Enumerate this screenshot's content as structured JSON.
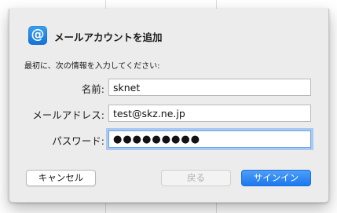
{
  "dialog": {
    "title": "メールアカウントを追加",
    "icon": "mail-at-icon",
    "icon_glyph": "@",
    "intro": "最初に、次の情報を入力してください:"
  },
  "form": {
    "name_label": "名前:",
    "name_value": "sknet",
    "email_label": "メールアドレス:",
    "email_value": "test@skz.ne.jp",
    "password_label": "パスワード:",
    "password_value": "●●●●●●●●●"
  },
  "buttons": {
    "cancel_label": "キャンセル",
    "back_label": "戻る",
    "signin_label": "サインイン"
  },
  "colors": {
    "accent": "#1c78ee",
    "sheet_background": "#ececec"
  }
}
